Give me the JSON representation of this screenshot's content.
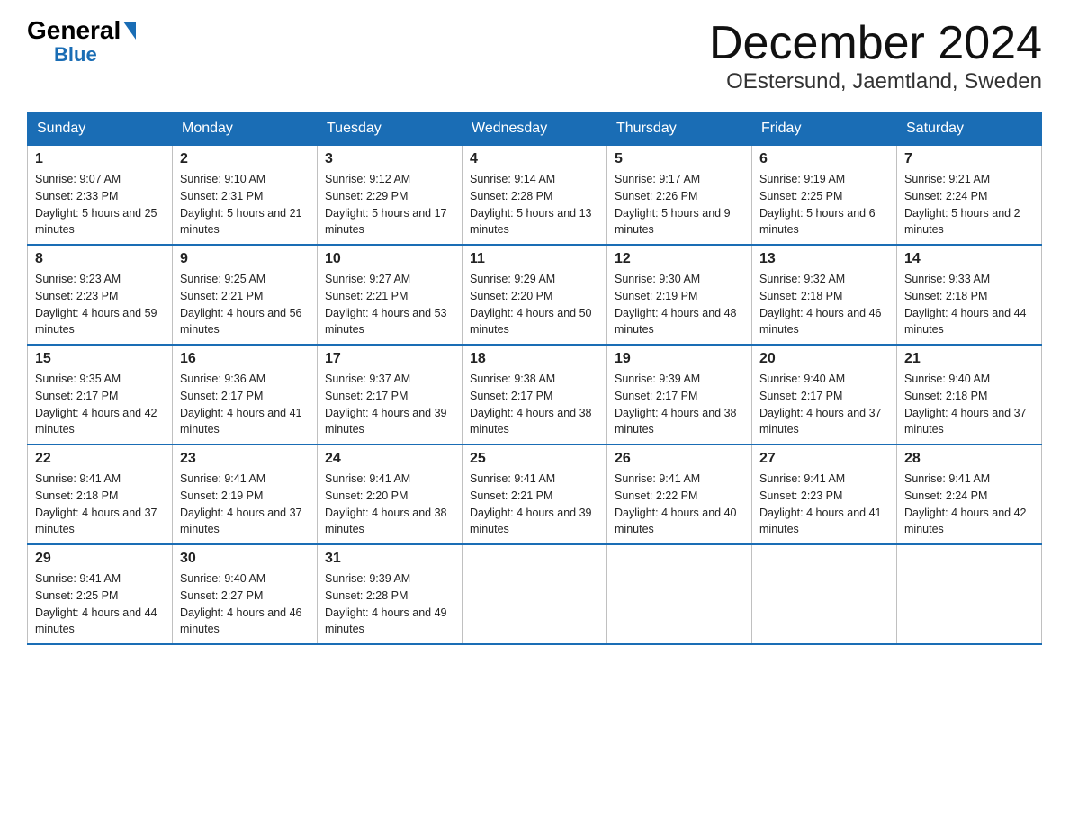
{
  "header": {
    "logo_general": "General",
    "logo_blue": "Blue",
    "month_title": "December 2024",
    "location": "OEstersund, Jaemtland, Sweden"
  },
  "days_of_week": [
    "Sunday",
    "Monday",
    "Tuesday",
    "Wednesday",
    "Thursday",
    "Friday",
    "Saturday"
  ],
  "weeks": [
    [
      {
        "day": "1",
        "sunrise": "9:07 AM",
        "sunset": "2:33 PM",
        "daylight": "5 hours and 25 minutes."
      },
      {
        "day": "2",
        "sunrise": "9:10 AM",
        "sunset": "2:31 PM",
        "daylight": "5 hours and 21 minutes."
      },
      {
        "day": "3",
        "sunrise": "9:12 AM",
        "sunset": "2:29 PM",
        "daylight": "5 hours and 17 minutes."
      },
      {
        "day": "4",
        "sunrise": "9:14 AM",
        "sunset": "2:28 PM",
        "daylight": "5 hours and 13 minutes."
      },
      {
        "day": "5",
        "sunrise": "9:17 AM",
        "sunset": "2:26 PM",
        "daylight": "5 hours and 9 minutes."
      },
      {
        "day": "6",
        "sunrise": "9:19 AM",
        "sunset": "2:25 PM",
        "daylight": "5 hours and 6 minutes."
      },
      {
        "day": "7",
        "sunrise": "9:21 AM",
        "sunset": "2:24 PM",
        "daylight": "5 hours and 2 minutes."
      }
    ],
    [
      {
        "day": "8",
        "sunrise": "9:23 AM",
        "sunset": "2:23 PM",
        "daylight": "4 hours and 59 minutes."
      },
      {
        "day": "9",
        "sunrise": "9:25 AM",
        "sunset": "2:21 PM",
        "daylight": "4 hours and 56 minutes."
      },
      {
        "day": "10",
        "sunrise": "9:27 AM",
        "sunset": "2:21 PM",
        "daylight": "4 hours and 53 minutes."
      },
      {
        "day": "11",
        "sunrise": "9:29 AM",
        "sunset": "2:20 PM",
        "daylight": "4 hours and 50 minutes."
      },
      {
        "day": "12",
        "sunrise": "9:30 AM",
        "sunset": "2:19 PM",
        "daylight": "4 hours and 48 minutes."
      },
      {
        "day": "13",
        "sunrise": "9:32 AM",
        "sunset": "2:18 PM",
        "daylight": "4 hours and 46 minutes."
      },
      {
        "day": "14",
        "sunrise": "9:33 AM",
        "sunset": "2:18 PM",
        "daylight": "4 hours and 44 minutes."
      }
    ],
    [
      {
        "day": "15",
        "sunrise": "9:35 AM",
        "sunset": "2:17 PM",
        "daylight": "4 hours and 42 minutes."
      },
      {
        "day": "16",
        "sunrise": "9:36 AM",
        "sunset": "2:17 PM",
        "daylight": "4 hours and 41 minutes."
      },
      {
        "day": "17",
        "sunrise": "9:37 AM",
        "sunset": "2:17 PM",
        "daylight": "4 hours and 39 minutes."
      },
      {
        "day": "18",
        "sunrise": "9:38 AM",
        "sunset": "2:17 PM",
        "daylight": "4 hours and 38 minutes."
      },
      {
        "day": "19",
        "sunrise": "9:39 AM",
        "sunset": "2:17 PM",
        "daylight": "4 hours and 38 minutes."
      },
      {
        "day": "20",
        "sunrise": "9:40 AM",
        "sunset": "2:17 PM",
        "daylight": "4 hours and 37 minutes."
      },
      {
        "day": "21",
        "sunrise": "9:40 AM",
        "sunset": "2:18 PM",
        "daylight": "4 hours and 37 minutes."
      }
    ],
    [
      {
        "day": "22",
        "sunrise": "9:41 AM",
        "sunset": "2:18 PM",
        "daylight": "4 hours and 37 minutes."
      },
      {
        "day": "23",
        "sunrise": "9:41 AM",
        "sunset": "2:19 PM",
        "daylight": "4 hours and 37 minutes."
      },
      {
        "day": "24",
        "sunrise": "9:41 AM",
        "sunset": "2:20 PM",
        "daylight": "4 hours and 38 minutes."
      },
      {
        "day": "25",
        "sunrise": "9:41 AM",
        "sunset": "2:21 PM",
        "daylight": "4 hours and 39 minutes."
      },
      {
        "day": "26",
        "sunrise": "9:41 AM",
        "sunset": "2:22 PM",
        "daylight": "4 hours and 40 minutes."
      },
      {
        "day": "27",
        "sunrise": "9:41 AM",
        "sunset": "2:23 PM",
        "daylight": "4 hours and 41 minutes."
      },
      {
        "day": "28",
        "sunrise": "9:41 AM",
        "sunset": "2:24 PM",
        "daylight": "4 hours and 42 minutes."
      }
    ],
    [
      {
        "day": "29",
        "sunrise": "9:41 AM",
        "sunset": "2:25 PM",
        "daylight": "4 hours and 44 minutes."
      },
      {
        "day": "30",
        "sunrise": "9:40 AM",
        "sunset": "2:27 PM",
        "daylight": "4 hours and 46 minutes."
      },
      {
        "day": "31",
        "sunrise": "9:39 AM",
        "sunset": "2:28 PM",
        "daylight": "4 hours and 49 minutes."
      },
      null,
      null,
      null,
      null
    ]
  ],
  "labels": {
    "sunrise": "Sunrise:",
    "sunset": "Sunset:",
    "daylight": "Daylight:"
  }
}
